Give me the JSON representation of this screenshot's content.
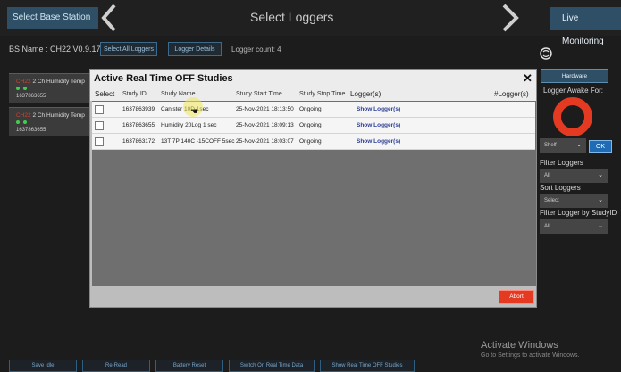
{
  "header": {
    "select_base_station": "Select Base Station",
    "title": "Select Loggers",
    "live_monitoring": "Live Monitoring"
  },
  "toolbar": {
    "bs_name": "BS Name : CH22 V0.9.17",
    "select_all": "Select All Loggers",
    "logger_details": "Logger Details",
    "logger_count": "Logger count: 4"
  },
  "cards": [
    {
      "red": "CH22",
      "label": "2 Ch Humidity Temp",
      "id": "1637863655"
    },
    {
      "red": "CH22",
      "label": "2 Ch Humidity Temp",
      "id": "1637863655"
    }
  ],
  "right_panel": {
    "hardware": "Hardware",
    "awake_label": "Logger Awake For:",
    "shelf_value": "Shelf",
    "ok": "OK",
    "filter_label": "Filter Loggers",
    "filter_value": "All",
    "sort_label": "Sort Loggers",
    "sort_value": "Select",
    "study_label": "Filter Logger by StudyID",
    "study_value": "All"
  },
  "modal": {
    "title": "Active Real Time OFF Studies",
    "close": "✕",
    "columns": [
      "Select",
      "Study ID",
      "Study Name",
      "Study Start Time",
      "Study Stop Time",
      "Logger(s)",
      "#Logger(s)"
    ],
    "rows": [
      {
        "study_id": "1637863939",
        "name": "Canister 10D 1sec",
        "start": "25-Nov-2021 18:13:50",
        "stop": "Ongoing",
        "loggers": "Show Logger(s)"
      },
      {
        "study_id": "1637863655",
        "name": "Humidity 20Log 1 sec",
        "start": "25-Nov-2021 18:09:13",
        "stop": "Ongoing",
        "loggers": "Show Logger(s)"
      },
      {
        "study_id": "1637863172",
        "name": "13T 7P 140C -15COFF 5sec",
        "start": "25-Nov-2021 18:03:07",
        "stop": "Ongoing",
        "loggers": "Show Logger(s)"
      }
    ],
    "abort": "Abort"
  },
  "bottom_buttons": [
    "Save Idle",
    "Re-Read",
    "Battery Reset",
    "Switch On Real Time Data",
    "Show Real Time OFF Studies"
  ],
  "watermark": {
    "title": "Activate Windows",
    "subtitle": "Go to Settings to activate Windows."
  },
  "colors": {
    "accent_blue": "#2e4f66",
    "danger_red": "#e43a22",
    "status_green": "#3fcf4c"
  }
}
